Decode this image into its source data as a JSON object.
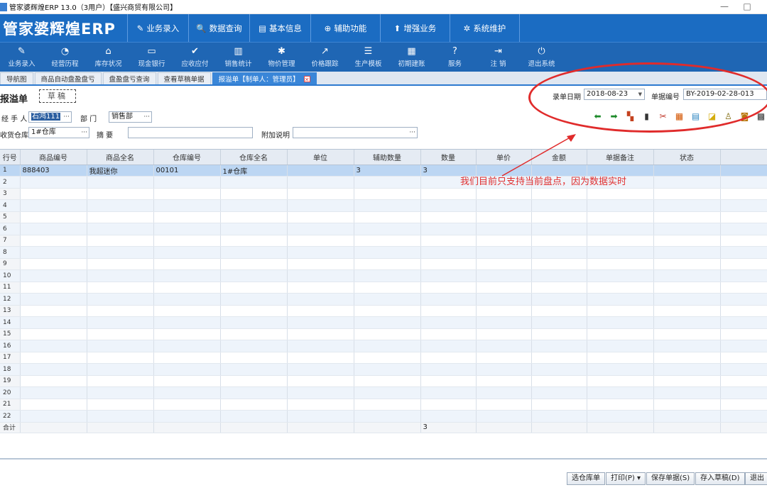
{
  "window": {
    "title": "管家婆辉煌ERP 13.0（3用户）【盛兴商贸有限公司】",
    "min": "—",
    "max": "□"
  },
  "logo": "管家婆辉煌ERP",
  "top_nav": [
    {
      "icon": "✎",
      "icon_name": "pencil-icon",
      "label": "业务录入"
    },
    {
      "icon": "🔍",
      "icon_name": "search-icon",
      "label": "数据查询"
    },
    {
      "icon": "▤",
      "icon_name": "card-icon",
      "label": "基本信息"
    },
    {
      "icon": "⊕",
      "icon_name": "lifebuoy-icon",
      "label": "辅助功能"
    },
    {
      "icon": "⬆",
      "icon_name": "arrow-up-icon",
      "label": "增强业务"
    },
    {
      "icon": "✲",
      "icon_name": "gear-icon",
      "label": "系统维护"
    }
  ],
  "toolbar": [
    {
      "icon": "✎",
      "icon_name": "pencil-icon",
      "label": "业务录入"
    },
    {
      "icon": "◔",
      "icon_name": "clock-icon",
      "label": "经营历程"
    },
    {
      "icon": "⌂",
      "icon_name": "home-icon",
      "label": "库存状况"
    },
    {
      "icon": "▭",
      "icon_name": "book-icon",
      "label": "现金银行"
    },
    {
      "icon": "✔",
      "icon_name": "check-icon",
      "label": "应收应付"
    },
    {
      "icon": "▥",
      "icon_name": "bar-chart-icon",
      "label": "销售统计"
    },
    {
      "icon": "✱",
      "icon_name": "cog-icon",
      "label": "物价管理"
    },
    {
      "icon": "↗",
      "icon_name": "trend-arrow-icon",
      "label": "价格跟踪"
    },
    {
      "icon": "☰",
      "icon_name": "list-icon",
      "label": "生产模板"
    },
    {
      "icon": "▦",
      "icon_name": "grid-icon",
      "label": "初期建账"
    },
    {
      "icon": "?",
      "icon_name": "help-icon",
      "label": "服务"
    },
    {
      "icon": "⇥",
      "icon_name": "logout-icon",
      "label": "注  销"
    },
    {
      "icon": "⏻",
      "icon_name": "power-icon",
      "label": "退出系统"
    }
  ],
  "tabs": [
    {
      "label": "导航图",
      "active": false
    },
    {
      "label": "商品自动盘盈盘亏",
      "active": false
    },
    {
      "label": "盘盈盘亏查询",
      "active": false
    },
    {
      "label": "查看草稿单据",
      "active": false
    },
    {
      "label": "报溢单【制单人：管理员】",
      "active": true
    }
  ],
  "form": {
    "title": "报溢单",
    "draft_stamp": "草稿",
    "handler_label": "经 手 人",
    "handler_value": "石鸿111",
    "dept_label": "部  门",
    "dept_value": "销售部",
    "warehouse_label": "收货仓库",
    "warehouse_value": "1#仓库",
    "summary_label": "摘  要",
    "summary_value": "",
    "note_label": "附加说明",
    "note_value": "",
    "date_label": "录单日期",
    "date_value": "2018-08-23",
    "docno_label": "单据编号",
    "docno_value": "BY-2019-02-28-013"
  },
  "action_icons": [
    {
      "glyph": "⬅",
      "name": "back-arrow-icon",
      "color": "#1d8a2a"
    },
    {
      "glyph": "➡",
      "name": "forward-arrow-icon",
      "color": "#1d8a2a"
    },
    {
      "glyph": "▚",
      "name": "blocks-icon",
      "color": "#c4411e"
    },
    {
      "glyph": "▮",
      "name": "barcode-icon",
      "color": "#333333"
    },
    {
      "glyph": "✂",
      "name": "tools-icon",
      "color": "#c0392b"
    },
    {
      "glyph": "▦",
      "name": "table-icon",
      "color": "#d35400"
    },
    {
      "glyph": "▤",
      "name": "list-icon",
      "color": "#2e86c1"
    },
    {
      "glyph": "◪",
      "name": "box-icon",
      "color": "#d4ac0d"
    },
    {
      "glyph": "♙",
      "name": "user-icon",
      "color": "#7d6608"
    },
    {
      "glyph": "◙",
      "name": "picture-icon",
      "color": "#b9770e"
    },
    {
      "glyph": "▩",
      "name": "qr-icon",
      "color": "#333333"
    }
  ],
  "grid": {
    "columns": [
      "行号",
      "商品编号",
      "商品全名",
      "仓库编号",
      "仓库全名",
      "单位",
      "辅助数量",
      "数量",
      "单价",
      "金额",
      "单据备注",
      "状态",
      ""
    ],
    "rows": [
      [
        "1",
        "888403",
        "我超迷你",
        "00101",
        "1#仓库",
        "",
        "3",
        "3",
        "",
        "",
        "",
        "",
        ""
      ],
      [
        "2"
      ],
      [
        "3"
      ],
      [
        "4"
      ],
      [
        "5"
      ],
      [
        "6"
      ],
      [
        "7"
      ],
      [
        "8"
      ],
      [
        "9"
      ],
      [
        "10"
      ],
      [
        "11"
      ],
      [
        "12"
      ],
      [
        "13"
      ],
      [
        "14"
      ],
      [
        "15"
      ],
      [
        "16"
      ],
      [
        "17"
      ],
      [
        "18"
      ],
      [
        "19"
      ],
      [
        "20"
      ],
      [
        "21"
      ],
      [
        "22"
      ]
    ],
    "totals_label": "合计",
    "totals_qty": "3"
  },
  "annotation": "我们目前只支持当前盘点，因为数据实时",
  "buttons": [
    {
      "name": "select-warehouse-button",
      "label": "选仓库单"
    },
    {
      "name": "print-button",
      "label": "打印(P) ▾"
    },
    {
      "name": "save-button",
      "label": "保存单据(S)"
    },
    {
      "name": "save-draft-button",
      "label": "存入草稿(D)"
    },
    {
      "name": "exit-button",
      "label": "退出"
    }
  ],
  "colors": {
    "nav_blue": "#1b6cc2",
    "annotation_red": "#e02b2b",
    "selected_row": "#bcd6f3"
  }
}
